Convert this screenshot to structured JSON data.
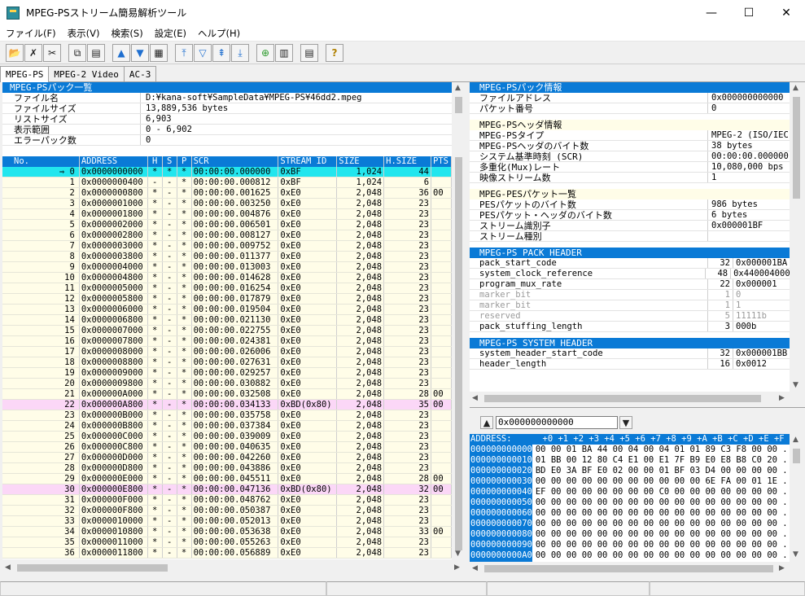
{
  "window": {
    "title": "MPEG-PSストリーム簡易解析ツール",
    "min": "—",
    "max": "☐",
    "close": "✕"
  },
  "menu": [
    "ファイル(F)",
    "表示(V)",
    "検索(S)",
    "設定(E)",
    "ヘルプ(H)"
  ],
  "tabs": [
    "MPEG-PS",
    "MPEG-2 Video",
    "AC-3"
  ],
  "summary": {
    "header": "MPEG-PSパック一覧",
    "rows": [
      {
        "k": "ファイル名",
        "v": "D:¥kana-soft¥SampleData¥MPEG-PS¥46dd2.mpeg"
      },
      {
        "k": "ファイルサイズ",
        "v": "13,889,536 bytes"
      },
      {
        "k": "リストサイズ",
        "v": "6,903"
      },
      {
        "k": "表示範囲",
        "v": "0 - 6,902"
      },
      {
        "k": "エラーパック数",
        "v": "0"
      }
    ]
  },
  "list": {
    "columns": [
      "No.",
      "ADDRESS",
      "H",
      "S",
      "P",
      "SCR",
      "STREAM ID",
      "SIZE",
      "H.SIZE",
      "PTS"
    ],
    "rows": [
      [
        "⇒    0",
        "0x0000000000",
        "*",
        "*",
        "*",
        "00:00:00.000000",
        "0xBF",
        "1,024",
        "44",
        ""
      ],
      [
        "1",
        "0x0000000400",
        "-",
        "-",
        "*",
        "00:00:00.000812",
        "0xBF",
        "1,024",
        "6",
        ""
      ],
      [
        "2",
        "0x0000000800",
        "*",
        "-",
        "*",
        "00:00:00.001625",
        "0xE0",
        "2,048",
        "36",
        "00"
      ],
      [
        "3",
        "0x0000001000",
        "*",
        "-",
        "*",
        "00:00:00.003250",
        "0xE0",
        "2,048",
        "23",
        ""
      ],
      [
        "4",
        "0x0000001800",
        "*",
        "-",
        "*",
        "00:00:00.004876",
        "0xE0",
        "2,048",
        "23",
        ""
      ],
      [
        "5",
        "0x0000002000",
        "*",
        "-",
        "*",
        "00:00:00.006501",
        "0xE0",
        "2,048",
        "23",
        ""
      ],
      [
        "6",
        "0x0000002800",
        "*",
        "-",
        "*",
        "00:00:00.008127",
        "0xE0",
        "2,048",
        "23",
        ""
      ],
      [
        "7",
        "0x0000003000",
        "*",
        "-",
        "*",
        "00:00:00.009752",
        "0xE0",
        "2,048",
        "23",
        ""
      ],
      [
        "8",
        "0x0000003800",
        "*",
        "-",
        "*",
        "00:00:00.011377",
        "0xE0",
        "2,048",
        "23",
        ""
      ],
      [
        "9",
        "0x0000004000",
        "*",
        "-",
        "*",
        "00:00:00.013003",
        "0xE0",
        "2,048",
        "23",
        ""
      ],
      [
        "10",
        "0x0000004800",
        "*",
        "-",
        "*",
        "00:00:00.014628",
        "0xE0",
        "2,048",
        "23",
        ""
      ],
      [
        "11",
        "0x0000005000",
        "*",
        "-",
        "*",
        "00:00:00.016254",
        "0xE0",
        "2,048",
        "23",
        ""
      ],
      [
        "12",
        "0x0000005800",
        "*",
        "-",
        "*",
        "00:00:00.017879",
        "0xE0",
        "2,048",
        "23",
        ""
      ],
      [
        "13",
        "0x0000006000",
        "*",
        "-",
        "*",
        "00:00:00.019504",
        "0xE0",
        "2,048",
        "23",
        ""
      ],
      [
        "14",
        "0x0000006800",
        "*",
        "-",
        "*",
        "00:00:00.021130",
        "0xE0",
        "2,048",
        "23",
        ""
      ],
      [
        "15",
        "0x0000007000",
        "*",
        "-",
        "*",
        "00:00:00.022755",
        "0xE0",
        "2,048",
        "23",
        ""
      ],
      [
        "16",
        "0x0000007800",
        "*",
        "-",
        "*",
        "00:00:00.024381",
        "0xE0",
        "2,048",
        "23",
        ""
      ],
      [
        "17",
        "0x0000008000",
        "*",
        "-",
        "*",
        "00:00:00.026006",
        "0xE0",
        "2,048",
        "23",
        ""
      ],
      [
        "18",
        "0x0000008800",
        "*",
        "-",
        "*",
        "00:00:00.027631",
        "0xE0",
        "2,048",
        "23",
        ""
      ],
      [
        "19",
        "0x0000009000",
        "*",
        "-",
        "*",
        "00:00:00.029257",
        "0xE0",
        "2,048",
        "23",
        ""
      ],
      [
        "20",
        "0x0000009800",
        "*",
        "-",
        "*",
        "00:00:00.030882",
        "0xE0",
        "2,048",
        "23",
        ""
      ],
      [
        "21",
        "0x000000A000",
        "*",
        "-",
        "*",
        "00:00:00.032508",
        "0xE0",
        "2,048",
        "28",
        "00"
      ],
      [
        "22",
        "0x000000A800",
        "*",
        "-",
        "*",
        "00:00:00.034133",
        "0xBD(0x80)",
        "2,048",
        "35",
        "00"
      ],
      [
        "23",
        "0x000000B000",
        "*",
        "-",
        "*",
        "00:00:00.035758",
        "0xE0",
        "2,048",
        "23",
        ""
      ],
      [
        "24",
        "0x000000B800",
        "*",
        "-",
        "*",
        "00:00:00.037384",
        "0xE0",
        "2,048",
        "23",
        ""
      ],
      [
        "25",
        "0x000000C000",
        "*",
        "-",
        "*",
        "00:00:00.039009",
        "0xE0",
        "2,048",
        "23",
        ""
      ],
      [
        "26",
        "0x000000C800",
        "*",
        "-",
        "*",
        "00:00:00.040635",
        "0xE0",
        "2,048",
        "23",
        ""
      ],
      [
        "27",
        "0x000000D000",
        "*",
        "-",
        "*",
        "00:00:00.042260",
        "0xE0",
        "2,048",
        "23",
        ""
      ],
      [
        "28",
        "0x000000D800",
        "*",
        "-",
        "*",
        "00:00:00.043886",
        "0xE0",
        "2,048",
        "23",
        ""
      ],
      [
        "29",
        "0x000000E000",
        "*",
        "-",
        "*",
        "00:00:00.045511",
        "0xE0",
        "2,048",
        "28",
        "00"
      ],
      [
        "30",
        "0x000000E800",
        "*",
        "-",
        "*",
        "00:00:00.047136",
        "0xBD(0x80)",
        "2,048",
        "32",
        "00"
      ],
      [
        "31",
        "0x000000F000",
        "*",
        "-",
        "*",
        "00:00:00.048762",
        "0xE0",
        "2,048",
        "23",
        ""
      ],
      [
        "32",
        "0x000000F800",
        "*",
        "-",
        "*",
        "00:00:00.050387",
        "0xE0",
        "2,048",
        "23",
        ""
      ],
      [
        "33",
        "0x0000010000",
        "*",
        "-",
        "*",
        "00:00:00.052013",
        "0xE0",
        "2,048",
        "23",
        ""
      ],
      [
        "34",
        "0x0000010800",
        "*",
        "-",
        "*",
        "00:00:00.053638",
        "0xE0",
        "2,048",
        "33",
        "00"
      ],
      [
        "35",
        "0x0000011000",
        "*",
        "-",
        "*",
        "00:00:00.055263",
        "0xE0",
        "2,048",
        "23",
        ""
      ],
      [
        "36",
        "0x0000011800",
        "*",
        "-",
        "*",
        "00:00:00.056889",
        "0xE0",
        "2,048",
        "23",
        ""
      ]
    ],
    "selected_row": 0,
    "pes_rows": [
      22,
      30
    ]
  },
  "info": {
    "pack_info": {
      "header": "MPEG-PSパック情報",
      "rows": [
        {
          "k": "ファイルアドレス",
          "v": "0x000000000000"
        },
        {
          "k": "パケット番号",
          "v": "0"
        }
      ]
    },
    "ps_header": {
      "header": "MPEG-PSヘッダ情報",
      "rows": [
        {
          "k": "MPEG-PSタイプ",
          "v": "MPEG-2 (ISO/IEC"
        },
        {
          "k": "MPEG-PSヘッダのバイト数",
          "v": "38 bytes"
        },
        {
          "k": "システム基準時刻 (SCR)",
          "v": "00:00:00.000000"
        },
        {
          "k": "多重化(Mux)レート",
          "v": "10,080,000 bps"
        },
        {
          "k": "映像ストリーム数",
          "v": "1"
        }
      ]
    },
    "pes_list": {
      "header": "MPEG-PESパケット一覧",
      "rows": [
        {
          "k": "PESパケットのバイト数",
          "v": "986 bytes"
        },
        {
          "k": "PESパケット・ヘッダのバイト数",
          "v": "6 bytes"
        },
        {
          "k": "ストリーム識別子",
          "v": "0x000001BF"
        },
        {
          "k": "ストリーム種別",
          "v": ""
        }
      ]
    },
    "pack_header": {
      "header": "MPEG-PS PACK HEADER",
      "rows": [
        {
          "k": "pack_start_code",
          "b": "32",
          "v": "0x000001BA",
          "gray": false
        },
        {
          "k": "system_clock_reference",
          "b": "48",
          "v": "0x440004000",
          "gray": false
        },
        {
          "k": "program_mux_rate",
          "b": "22",
          "v": "0x000001",
          "gray": false
        },
        {
          "k": "marker_bit",
          "b": "1",
          "v": "0",
          "gray": true
        },
        {
          "k": "marker_bit",
          "b": "1",
          "v": "1",
          "gray": true
        },
        {
          "k": "reserved",
          "b": "5",
          "v": "11111b",
          "gray": true
        },
        {
          "k": "pack_stuffing_length",
          "b": "3",
          "v": "000b",
          "gray": false
        }
      ]
    },
    "system_header": {
      "header": "MPEG-PS SYSTEM HEADER",
      "rows": [
        {
          "k": "system_header_start_code",
          "b": "32",
          "v": "0x000001BB",
          "gray": false
        },
        {
          "k": "header_length",
          "b": "16",
          "v": "0x0012",
          "gray": false
        }
      ]
    }
  },
  "hex": {
    "address_input": "0x000000000000",
    "header": "ADDRESS:      +0 +1 +2 +3 +4 +5 +6 +7 +8 +9 +A +B +C +D +E +F ASCI",
    "rows": [
      {
        "a": "000000000000",
        "h": "00 00 01 BA 44 00 04 00 04 01 01 89 C3 F8 00 00 ...."
      },
      {
        "a": "000000000010",
        "h": "01 BB 00 12 80 C4 E1 00 E1 7F B9 E0 E8 B8 C0 20 ...."
      },
      {
        "a": "000000000020",
        "h": "BD E0 3A BF E0 02 00 00 01 BF 03 D4 00 00 00 00 ..:."
      },
      {
        "a": "000000000030",
        "h": "00 00 00 00 00 00 00 00 00 00 00 6E FA 00 01 1E ...."
      },
      {
        "a": "000000000040",
        "h": "EF 00 00 00 00 00 00 00 C0 00 00 00 00 00 00 00 ...."
      },
      {
        "a": "000000000050",
        "h": "00 00 00 00 00 00 00 00 00 00 00 00 00 00 00 00 ...."
      },
      {
        "a": "000000000060",
        "h": "00 00 00 00 00 00 00 00 00 00 00 00 00 00 00 00 ...."
      },
      {
        "a": "000000000070",
        "h": "00 00 00 00 00 00 00 00 00 00 00 00 00 00 00 00 ...."
      },
      {
        "a": "000000000080",
        "h": "00 00 00 00 00 00 00 00 00 00 00 00 00 00 00 00 ...."
      },
      {
        "a": "000000000090",
        "h": "00 00 00 00 00 00 00 00 00 00 00 00 00 00 00 00 ...."
      },
      {
        "a": "0000000000A0",
        "h": "00 00 00 00 00 00 00 00 00 00 00 00 00 00 00 00 ...."
      },
      {
        "a": "0000000000B0",
        "h": "00 00 00 00 00 00 00 00 00 00 00 00 00 00 00 00 ...."
      }
    ]
  },
  "colors": {
    "header_blue": "#0a7ad6",
    "row_yellow": "#fffde8",
    "row_cyan": "#22e6ee",
    "row_pink": "#fbd7f7"
  }
}
